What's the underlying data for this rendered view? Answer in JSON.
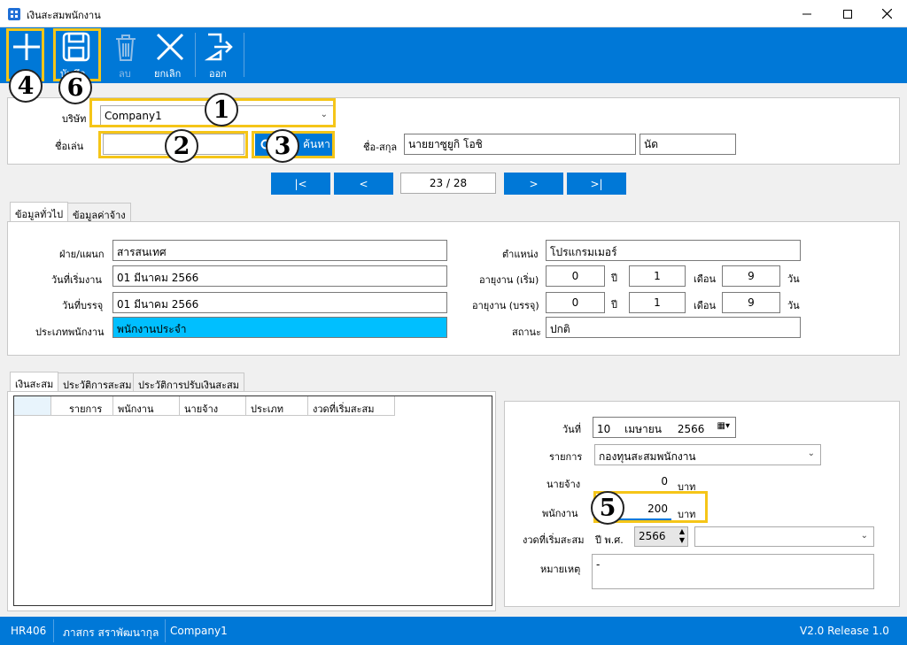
{
  "window": {
    "title": "เงินสะสมพนักงาน",
    "minimize_icon": "minimize-icon",
    "maximize_icon": "maximize-icon",
    "close_icon": "close-icon"
  },
  "toolbar": {
    "add_label": "",
    "save_label": "บันทึก",
    "delete_label": "ลบ",
    "cancel_label": "ยกเลิก",
    "exit_label": "ออก"
  },
  "annotations": [
    "1",
    "2",
    "3",
    "4",
    "5",
    "6"
  ],
  "search": {
    "company_label": "บริษัท",
    "company_value": "Company1",
    "nickname_label": "ชื่อเล่น",
    "nickname_value": "",
    "search_button": "ค้นหา",
    "fullname_label": "ชื่อ-สกุล",
    "fullname_value": "นายยาซูยูกิ  โอชิ",
    "nick_display": "นัด"
  },
  "navigation": {
    "first": "|<",
    "prev": "<",
    "position": "23 / 28",
    "next": ">",
    "last": ">|"
  },
  "info_tabs": [
    "ข้อมูลทั่วไป",
    "ข้อมูลค่าจ้าง"
  ],
  "general": {
    "department_label": "ฝ่าย/แผนก",
    "department_value": "สารสนเทศ",
    "start_date_label": "วันที่เริ่มงาน",
    "start_date_value": "01 มีนาคม 2566",
    "permanent_date_label": "วันที่บรรจุ",
    "permanent_date_value": "01 มีนาคม 2566",
    "emp_type_label": "ประเภทพนักงาน",
    "emp_type_value": "พนักงานประจำ",
    "position_label": "ตำแหน่ง",
    "position_value": "โปรแกรมเมอร์",
    "tenure_start_label": "อายุงาน (เริ่ม)",
    "tenure_start_years": "0",
    "tenure_start_months": "1",
    "tenure_start_days": "9",
    "tenure_perm_label": "อายุงาน (บรรจุ)",
    "tenure_perm_years": "0",
    "tenure_perm_months": "1",
    "tenure_perm_days": "9",
    "year_unit": "ปี",
    "month_unit": "เดือน",
    "day_unit": "วัน",
    "status_label": "สถานะ",
    "status_value": "ปกติ"
  },
  "savings_tabs": [
    "เงินสะสม",
    "ประวัติการสะสม",
    "ประวัติการปรับเงินสะสม"
  ],
  "grid_columns": [
    "",
    "รายการ",
    "พนักงาน",
    "นายจ้าง",
    "ประเภท",
    "งวดที่เริ่มสะสม"
  ],
  "form": {
    "date_label": "วันที่",
    "date_day": "10",
    "date_month": "เมษายน",
    "date_year": "2566",
    "item_label": "รายการ",
    "item_value": "กองทุนสะสมพนักงาน",
    "employer_label": "นายจ้าง",
    "employer_value": "0",
    "employee_label": "พนักงาน",
    "employee_value": "200",
    "baht": "บาท",
    "start_period_label": "งวดที่เริ่มสะสม",
    "year_prefix": "ปี พ.ศ.",
    "start_year": "2566",
    "period_value": "",
    "note_label": "หมายเหตุ",
    "note_value": "-"
  },
  "status_bar": {
    "code": "HR406",
    "user": "ภาสกร สราพัฒนากุล",
    "company": "Company1",
    "version": "V2.0 Release 1.0"
  }
}
